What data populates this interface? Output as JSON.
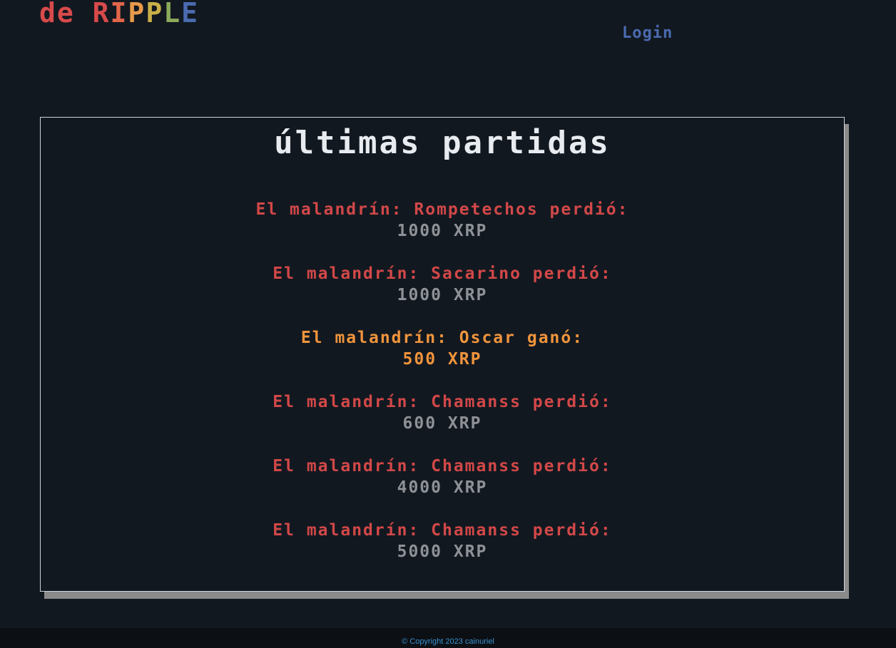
{
  "header": {
    "logo_prefix": "de ",
    "logo_letters": [
      {
        "char": "R",
        "color": "#d84a4a"
      },
      {
        "char": "I",
        "color": "#e0664a"
      },
      {
        "char": "P",
        "color": "#e89a4a"
      },
      {
        "char": "P",
        "color": "#c9b048"
      },
      {
        "char": "L",
        "color": "#8caa5a"
      },
      {
        "char": "E",
        "color": "#4a6bb0"
      }
    ],
    "logo_prefix_color": "#d84a4a",
    "login_label": "Login"
  },
  "main": {
    "title": "últimas partidas",
    "games": [
      {
        "result": "lost",
        "text": "El malandrín: Rompetechos perdió:",
        "amount": "1000 XRP"
      },
      {
        "result": "lost",
        "text": "El malandrín: Sacarino perdió:",
        "amount": "1000 XRP"
      },
      {
        "result": "won",
        "text": "El malandrín: Oscar ganó:",
        "amount": "500 XRP"
      },
      {
        "result": "lost",
        "text": "El malandrín: Chamanss perdió:",
        "amount": "600 XRP"
      },
      {
        "result": "lost",
        "text": "El malandrín: Chamanss perdió:",
        "amount": "4000 XRP"
      },
      {
        "result": "lost",
        "text": "El malandrín: Chamanss perdió:",
        "amount": "5000 XRP"
      }
    ]
  },
  "footer": {
    "copyright": "© Copyright 2023 cainuriel"
  },
  "colors": {
    "background": "#121820",
    "lost": "#d24848",
    "lost_amount": "#8e9196",
    "won": "#f0943c",
    "login": "#4a6bb0"
  }
}
